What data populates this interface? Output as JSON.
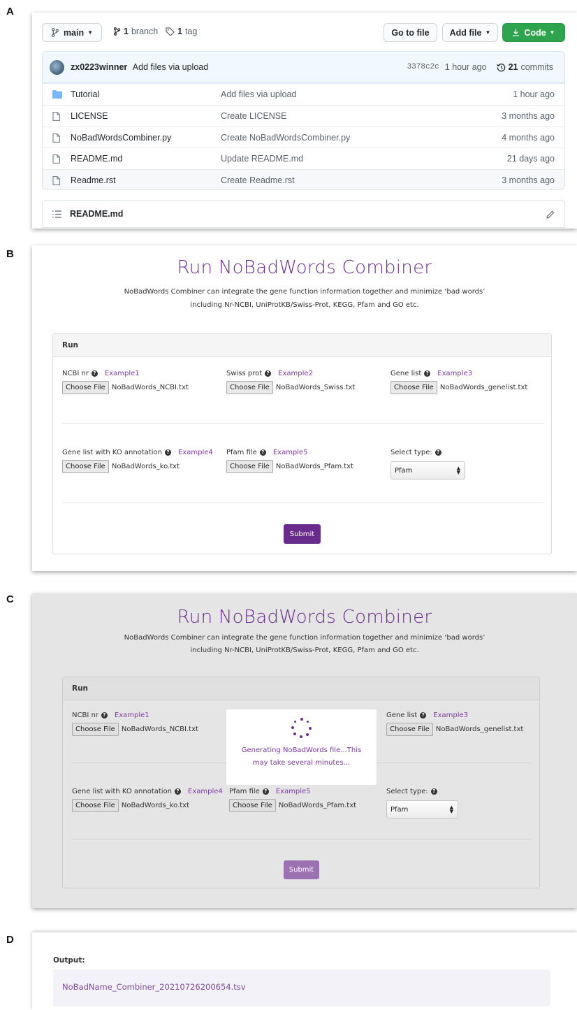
{
  "panel_labels": {
    "a": "A",
    "b": "B",
    "c": "C",
    "d": "D"
  },
  "github": {
    "branch_selector": "main",
    "branches_count": "1",
    "branches_label": "branch",
    "tags_count": "1",
    "tags_label": "tag",
    "go_to_file": "Go to file",
    "add_file": "Add file",
    "code": "Code",
    "commit": {
      "author": "zx0223winner",
      "message": "Add files via upload",
      "sha": "3378c2c",
      "time": "1 hour ago",
      "commits_count": "21",
      "commits_label": "commits"
    },
    "files": [
      {
        "name": "Tutorial",
        "type": "folder",
        "message": "Add files via upload",
        "age": "1 hour ago"
      },
      {
        "name": "LICENSE",
        "type": "file",
        "message": "Create LICENSE",
        "age": "3 months ago"
      },
      {
        "name": "NoBadWordsCombiner.py",
        "type": "file",
        "message": "Create NoBadWordsCombiner.py",
        "age": "4 months ago"
      },
      {
        "name": "README.md",
        "type": "file",
        "message": "Update README.md",
        "age": "21 days ago"
      },
      {
        "name": "Readme.rst",
        "type": "file",
        "message": "Create Readme.rst",
        "age": "3 months ago"
      }
    ],
    "readme_title": "README.md"
  },
  "app": {
    "title": "Run NoBadWords Combiner",
    "desc_line1": "NoBadWords Combiner can integrate the gene function information together and minimize ‘bad words’",
    "desc_line2": "including Nr-NCBI, UniProtKB/Swiss-Prot, KEGG, Pfam and GO etc.",
    "panel_heading": "Run",
    "choose_file": "Choose File",
    "fields": {
      "ncbi": {
        "label": "NCBI nr",
        "example": "Example1",
        "file": "NoBadWords_NCBI.txt"
      },
      "swiss": {
        "label": "Swiss prot",
        "example": "Example2",
        "file": "NoBadWords_Swiss.txt"
      },
      "genelist": {
        "label": "Gene list",
        "example": "Example3",
        "file": "NoBadWords_genelist.txt"
      },
      "ko": {
        "label": "Gene list with KO annotation",
        "example": "Example4",
        "file": "NoBadWords_ko.txt"
      },
      "pfam": {
        "label": "Pfam file",
        "example": "Example5",
        "file": "NoBadWords_Pfam.txt"
      },
      "type": {
        "label": "Select type:",
        "selected": "Pfam"
      }
    },
    "submit": "Submit",
    "loading_text": "Generating NoBadWords file...This may take several minutes..."
  },
  "output": {
    "label": "Output:",
    "filename": "NoBadName_Combiner_20210726200654.tsv"
  },
  "colors": {
    "accent_purple": "#6a2c8c",
    "github_green": "#2ea44f",
    "folder_blue": "#79b8ff"
  },
  "icons": [
    "branch-icon",
    "tag-icon",
    "history-icon",
    "folder-icon",
    "file-icon",
    "list-icon",
    "pencil-icon",
    "download-icon",
    "help-icon",
    "spinner-icon"
  ]
}
